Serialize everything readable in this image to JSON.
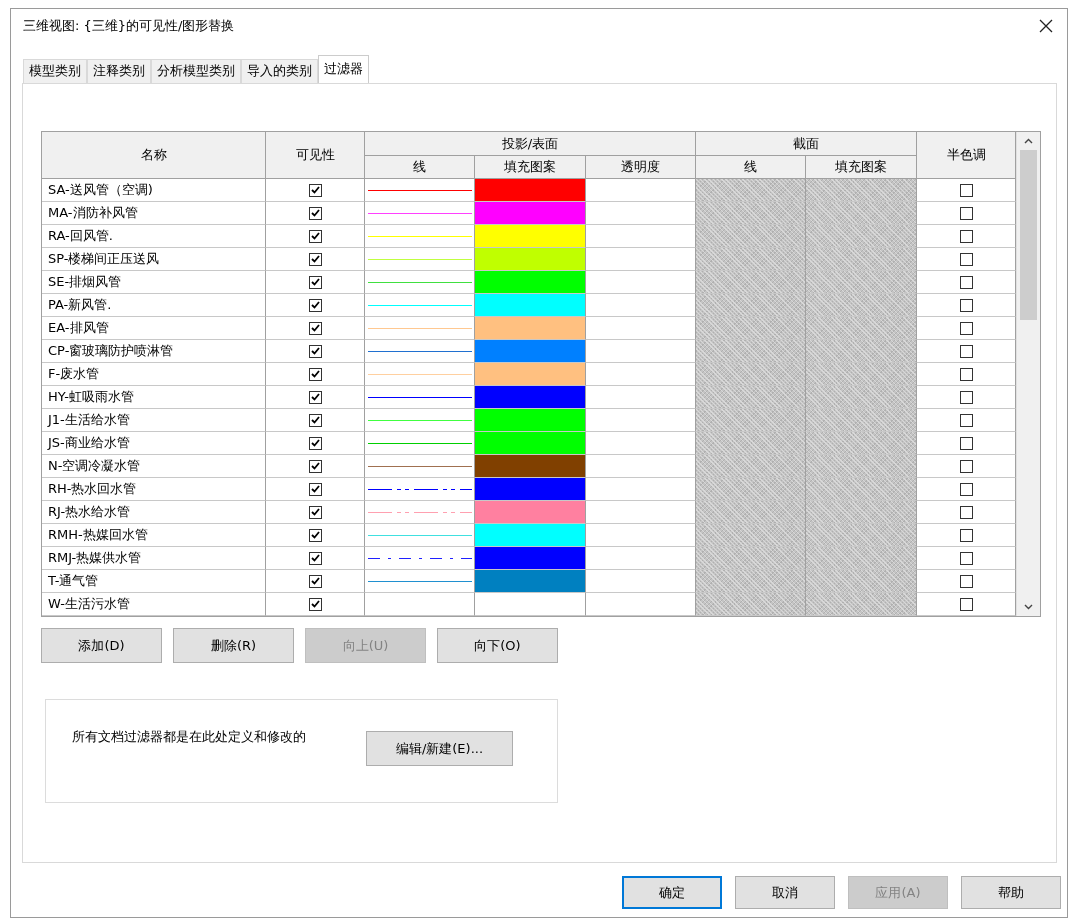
{
  "window": {
    "title": "三维视图: {三维}的可见性/图形替换"
  },
  "tabs": [
    {
      "label": "模型类别",
      "selected": false
    },
    {
      "label": "注释类别",
      "selected": false
    },
    {
      "label": "分析模型类别",
      "selected": false
    },
    {
      "label": "导入的类别",
      "selected": false
    },
    {
      "label": "过滤器",
      "selected": true
    }
  ],
  "table": {
    "columns": {
      "name": "名称",
      "visibility": "可见性",
      "projection": {
        "title": "投影/表面",
        "line": "线",
        "fill": "填充图案",
        "transparency": "透明度"
      },
      "cut": {
        "title": "截面",
        "line": "线",
        "fill": "填充图案"
      },
      "halftone": "半色调"
    },
    "rows": [
      {
        "name": "SA-送风管（空调)",
        "visible": true,
        "line": {
          "color": "#ff0000",
          "kind": "solid"
        },
        "fill": {
          "color": "#ff0000"
        },
        "halftone": false
      },
      {
        "name": "MA-消防补风管",
        "visible": true,
        "line": {
          "color": "#ff40ff",
          "kind": "solid"
        },
        "fill": {
          "color": "#ff00ff"
        },
        "halftone": false
      },
      {
        "name": "RA-回风管.",
        "visible": true,
        "line": {
          "color": "#ffff00",
          "kind": "solid"
        },
        "fill": {
          "color": "#ffff00"
        },
        "halftone": false
      },
      {
        "name": "SP-楼梯间正压送风",
        "visible": true,
        "line": {
          "color": "#c0ff40",
          "kind": "solid"
        },
        "fill": {
          "color": "#c0ff00"
        },
        "halftone": false
      },
      {
        "name": "SE-排烟风管",
        "visible": true,
        "line": {
          "color": "#40e040",
          "kind": "solid"
        },
        "fill": {
          "color": "#00ff00"
        },
        "halftone": false
      },
      {
        "name": "PA-新风管.",
        "visible": true,
        "line": {
          "color": "#00ffff",
          "kind": "solid"
        },
        "fill": {
          "color": "#00ffff"
        },
        "halftone": false
      },
      {
        "name": "EA-排风管",
        "visible": true,
        "line": {
          "color": "#ffc890",
          "kind": "solid"
        },
        "fill": {
          "color": "#ffc080"
        },
        "halftone": false
      },
      {
        "name": "CP-窗玻璃防护喷淋管",
        "visible": true,
        "line": {
          "color": "#2070d0",
          "kind": "solid"
        },
        "fill": {
          "color": "#0080ff"
        },
        "halftone": false
      },
      {
        "name": "F-废水管",
        "visible": true,
        "line": {
          "color": "#ffd0a0",
          "kind": "solid"
        },
        "fill": {
          "color": "#ffc080"
        },
        "halftone": false
      },
      {
        "name": "HY-虹吸雨水管",
        "visible": true,
        "line": {
          "color": "#0000ff",
          "kind": "solid"
        },
        "fill": {
          "color": "#0000ff"
        },
        "halftone": false
      },
      {
        "name": "J1-生活给水管",
        "visible": true,
        "line": {
          "color": "#40ff40",
          "kind": "solid"
        },
        "fill": {
          "color": "#00ff00"
        },
        "halftone": false
      },
      {
        "name": "JS-商业给水管",
        "visible": true,
        "line": {
          "color": "#00d000",
          "kind": "solid"
        },
        "fill": {
          "color": "#00ff00"
        },
        "halftone": false
      },
      {
        "name": "N-空调冷凝水管",
        "visible": true,
        "line": {
          "color": "#a07050",
          "kind": "solid"
        },
        "fill": {
          "color": "#804000"
        },
        "halftone": false
      },
      {
        "name": "RH-热水回水管",
        "visible": true,
        "line": {
          "color": "#0000ff",
          "kind": "dashdotdot"
        },
        "fill": {
          "color": "#0000ff"
        },
        "halftone": false
      },
      {
        "name": "RJ-热水给水管",
        "visible": true,
        "line": {
          "color": "#ffa0b0",
          "kind": "dashdotdot"
        },
        "fill": {
          "color": "#ff80a0"
        },
        "halftone": false
      },
      {
        "name": "RMH-热媒回水管",
        "visible": true,
        "line": {
          "color": "#40e0e0",
          "kind": "solid"
        },
        "fill": {
          "color": "#00ffff"
        },
        "halftone": false
      },
      {
        "name": "RMJ-热媒供水管",
        "visible": true,
        "line": {
          "color": "#2020ff",
          "kind": "dashdot"
        },
        "fill": {
          "color": "#0000ff"
        },
        "halftone": false
      },
      {
        "name": "T-通气管",
        "visible": true,
        "line": {
          "color": "#2090d0",
          "kind": "solid"
        },
        "fill": {
          "color": "#0080c0"
        },
        "halftone": false
      },
      {
        "name": "W-生活污水管",
        "visible": true,
        "halftone": false
      }
    ]
  },
  "row_buttons": [
    {
      "label": "添加(D)",
      "disabled": false
    },
    {
      "label": "删除(R)",
      "disabled": false
    },
    {
      "label": "向上(U)",
      "disabled": true
    },
    {
      "label": "向下(O)",
      "disabled": false
    }
  ],
  "note": {
    "text": "所有文档过滤器都是在此处定义和修改的",
    "button": "编辑/新建(E)..."
  },
  "footer_buttons": [
    {
      "label": "确定",
      "default": true,
      "disabled": false
    },
    {
      "label": "取消",
      "default": false,
      "disabled": false
    },
    {
      "label": "应用(A)",
      "default": false,
      "disabled": true
    },
    {
      "label": "帮助",
      "default": false,
      "disabled": false
    }
  ]
}
